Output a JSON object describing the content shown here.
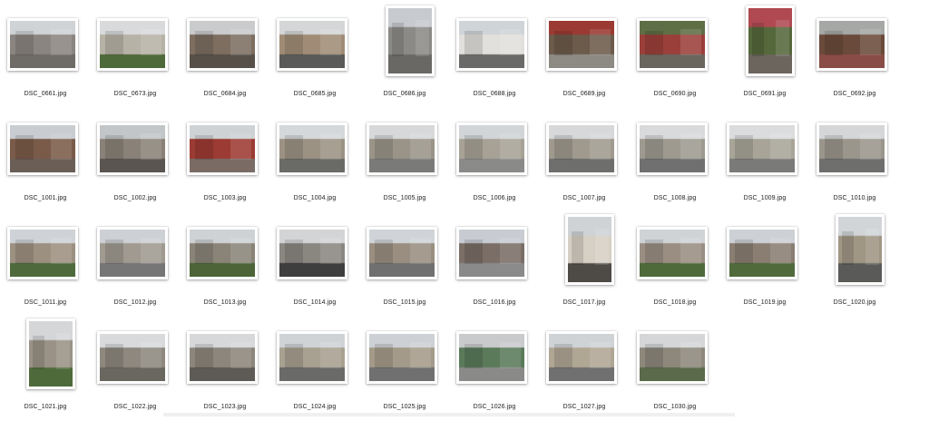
{
  "files": [
    {
      "name": "DSC_0661.jpg",
      "orient": "land",
      "palette": [
        "#cfd3d6",
        "#8a8580",
        "#6f6b66"
      ]
    },
    {
      "name": "DSC_0673.jpg",
      "orient": "land",
      "palette": [
        "#d8dadb",
        "#b7b2a6",
        "#4f6a3a"
      ]
    },
    {
      "name": "DSC_0684.jpg",
      "orient": "land",
      "palette": [
        "#c9cbcc",
        "#7d6e60",
        "#565049"
      ]
    },
    {
      "name": "DSC_0685.jpg",
      "orient": "land",
      "palette": [
        "#d4d6d8",
        "#a08c76",
        "#5a5a58"
      ]
    },
    {
      "name": "DSC_0686.jpg",
      "orient": "port",
      "palette": [
        "#c7cbcf",
        "#8b8a86",
        "#6a6865"
      ]
    },
    {
      "name": "DSC_0688.jpg",
      "orient": "land",
      "palette": [
        "#cfd4d8",
        "#e2e0dc",
        "#6a6a68"
      ]
    },
    {
      "name": "DSC_0689.jpg",
      "orient": "land",
      "palette": [
        "#9b3a32",
        "#6c5a4b",
        "#8d8a84"
      ]
    },
    {
      "name": "DSC_0690.jpg",
      "orient": "land",
      "palette": [
        "#5e6f45",
        "#9b3f3a",
        "#6a665e"
      ]
    },
    {
      "name": "DSC_0691.jpg",
      "orient": "port",
      "palette": [
        "#b04952",
        "#55683c",
        "#6c655e"
      ]
    },
    {
      "name": "DSC_0692.jpg",
      "orient": "land",
      "palette": [
        "#a6a8a6",
        "#6a4a3a",
        "#8a4c46"
      ]
    },
    {
      "name": "DSC_1001.jpg",
      "orient": "land",
      "palette": [
        "#c9ccd0",
        "#7a5a48",
        "#6a5e56"
      ]
    },
    {
      "name": "DSC_1002.jpg",
      "orient": "land",
      "palette": [
        "#c3c6c8",
        "#8a8278",
        "#5a5550"
      ]
    },
    {
      "name": "DSC_1003.jpg",
      "orient": "land",
      "palette": [
        "#cfd2d4",
        "#9c3b33",
        "#7a6c64"
      ]
    },
    {
      "name": "DSC_1004.jpg",
      "orient": "land",
      "palette": [
        "#d5d8da",
        "#9c9284",
        "#6a6a66"
      ]
    },
    {
      "name": "DSC_1005.jpg",
      "orient": "land",
      "palette": [
        "#d6d8da",
        "#9a9488",
        "#7a7a78"
      ]
    },
    {
      "name": "DSC_1006.jpg",
      "orient": "land",
      "palette": [
        "#d2d5d8",
        "#a8a296",
        "#8a8a88"
      ]
    },
    {
      "name": "DSC_1007.jpg",
      "orient": "land",
      "palette": [
        "#d6d8da",
        "#a09a8e",
        "#6e6e6c"
      ]
    },
    {
      "name": "DSC_1008.jpg",
      "orient": "land",
      "palette": [
        "#d8dadc",
        "#9e9a90",
        "#707070"
      ]
    },
    {
      "name": "DSC_1009.jpg",
      "orient": "land",
      "palette": [
        "#dadcde",
        "#a8a498",
        "#7a7a78"
      ]
    },
    {
      "name": "DSC_1010.jpg",
      "orient": "land",
      "palette": [
        "#d4d6d8",
        "#9a968c",
        "#6e6e6c"
      ]
    },
    {
      "name": "DSC_1011.jpg",
      "orient": "land",
      "palette": [
        "#cfd2d6",
        "#9c9080",
        "#4e6a3c"
      ]
    },
    {
      "name": "DSC_1012.jpg",
      "orient": "land",
      "palette": [
        "#cdd0d4",
        "#a09a90",
        "#767676"
      ]
    },
    {
      "name": "DSC_1013.jpg",
      "orient": "land",
      "palette": [
        "#cfd2d4",
        "#8a8478",
        "#4c6438"
      ]
    },
    {
      "name": "DSC_1014.jpg",
      "orient": "land",
      "palette": [
        "#d2d4d6",
        "#8a8680",
        "#3e3e3e"
      ]
    },
    {
      "name": "DSC_1015.jpg",
      "orient": "land",
      "palette": [
        "#d0d4d8",
        "#9a8e80",
        "#707070"
      ]
    },
    {
      "name": "DSC_1016.jpg",
      "orient": "land",
      "palette": [
        "#c8ccd2",
        "#7a6e66",
        "#8a8a8a"
      ]
    },
    {
      "name": "DSC_1017.jpg",
      "orient": "port",
      "palette": [
        "#cfd3d6",
        "#d6d0c4",
        "#4e4a46"
      ]
    },
    {
      "name": "DSC_1018.jpg",
      "orient": "land",
      "palette": [
        "#d0d3d6",
        "#9a8e82",
        "#4e6a3a"
      ]
    },
    {
      "name": "DSC_1019.jpg",
      "orient": "land",
      "palette": [
        "#cdd0d4",
        "#8a7e72",
        "#506a3c"
      ]
    },
    {
      "name": "DSC_1020.jpg",
      "orient": "port",
      "palette": [
        "#d2d5d8",
        "#a09684",
        "#5a5a58"
      ]
    },
    {
      "name": "DSC_1021.jpg",
      "orient": "port",
      "palette": [
        "#d4d6d8",
        "#9a9286",
        "#4e6a3a"
      ]
    },
    {
      "name": "DSC_1022.jpg",
      "orient": "land",
      "palette": [
        "#d8dadc",
        "#8e887e",
        "#6a6660"
      ]
    },
    {
      "name": "DSC_1023.jpg",
      "orient": "land",
      "palette": [
        "#d6d8da",
        "#8c867c",
        "#5e5a56"
      ]
    },
    {
      "name": "DSC_1024.jpg",
      "orient": "land",
      "palette": [
        "#d0d3d6",
        "#a8a090",
        "#6a6a68"
      ]
    },
    {
      "name": "DSC_1025.jpg",
      "orient": "land",
      "palette": [
        "#cdd0d4",
        "#a49a8a",
        "#707070"
      ]
    },
    {
      "name": "DSC_1026.jpg",
      "orient": "land",
      "palette": [
        "#c8cacc",
        "#5a7a5a",
        "#8a8a88"
      ]
    },
    {
      "name": "DSC_1027.jpg",
      "orient": "land",
      "palette": [
        "#d0d3d6",
        "#b0a694",
        "#707070"
      ]
    },
    {
      "name": "DSC_1030.jpg",
      "orient": "land",
      "palette": [
        "#d4d6d8",
        "#8e887c",
        "#5a6a4a"
      ]
    }
  ]
}
